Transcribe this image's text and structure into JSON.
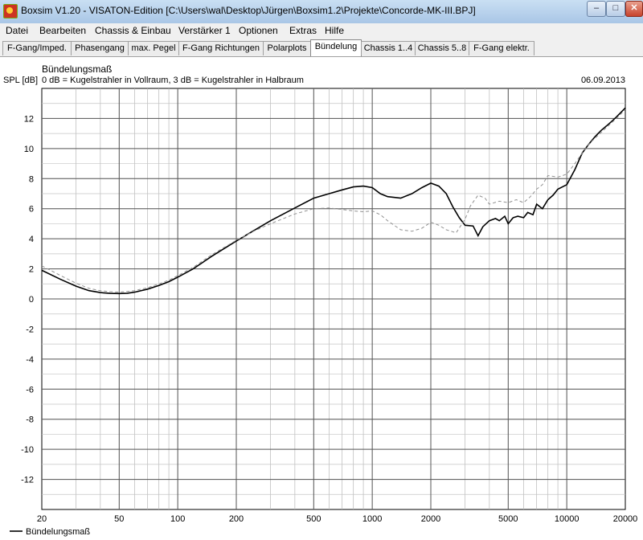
{
  "window": {
    "title": "Boxsim V1.20 - VISATON-Edition [C:\\Users\\wal\\Desktop\\Jürgen\\Boxsim1.2\\Projekte\\Concorde-MK-III.BPJ]",
    "icon": "boxsim-app-icon",
    "controls": {
      "minimize": "–",
      "maximize": "□",
      "close": "✕"
    }
  },
  "menu": [
    "Datei",
    "Bearbeiten",
    "Chassis & Einbau",
    "Verstärker 1",
    "Optionen",
    "Extras",
    "Hilfe"
  ],
  "tabs": [
    {
      "label": "F-Gang/Imped.",
      "active": false
    },
    {
      "label": "Phasengang",
      "active": false
    },
    {
      "label": "max. Pegel",
      "active": false
    },
    {
      "label": "F-Gang Richtungen",
      "active": false
    },
    {
      "label": "Polarplots",
      "active": false
    },
    {
      "label": "Bündelung",
      "active": true
    },
    {
      "label": "Chassis 1..4",
      "active": false
    },
    {
      "label": "Chassis 5..8",
      "active": false
    },
    {
      "label": "F-Gang elektr.",
      "active": false
    }
  ],
  "chart_data": {
    "type": "line",
    "title": "Bündelungsmaß",
    "subtitle": "0 dB = Kugelstrahler in Vollraum, 3 dB = Kugelstrahler in Halbraum",
    "date": "06.09.2013",
    "ylabel": "SPL [dB]",
    "xlabel": "",
    "x_scale": "log",
    "xlim": [
      20,
      20000
    ],
    "ylim": [
      -14,
      14
    ],
    "grid": true,
    "x_ticks": [
      20,
      50,
      100,
      200,
      500,
      1000,
      2000,
      5000,
      10000,
      20000
    ],
    "x_tick_labels": [
      "20",
      "50",
      "100",
      "200",
      "500",
      "1000",
      "2000",
      "5000",
      "10000",
      "20000"
    ],
    "y_ticks": [
      12,
      10,
      8,
      6,
      4,
      2,
      0,
      -2,
      -4,
      -6,
      -8,
      -10,
      -12
    ],
    "y_tick_labels": [
      "12",
      "10",
      "8",
      "6",
      "4",
      "2",
      "0",
      "-2",
      "-4",
      "-6",
      "-8",
      "-10",
      "-12"
    ],
    "legend_position": "bottom-left",
    "series": [
      {
        "name": "Bündelungsmaß",
        "style": "solid",
        "color": "#000000",
        "points": [
          [
            20,
            1.9
          ],
          [
            25,
            1.3
          ],
          [
            30,
            0.85
          ],
          [
            35,
            0.55
          ],
          [
            40,
            0.42
          ],
          [
            45,
            0.37
          ],
          [
            50,
            0.36
          ],
          [
            55,
            0.38
          ],
          [
            60,
            0.45
          ],
          [
            70,
            0.65
          ],
          [
            80,
            0.9
          ],
          [
            90,
            1.15
          ],
          [
            100,
            1.45
          ],
          [
            120,
            2.0
          ],
          [
            150,
            2.85
          ],
          [
            200,
            3.85
          ],
          [
            250,
            4.6
          ],
          [
            300,
            5.2
          ],
          [
            400,
            6.05
          ],
          [
            500,
            6.7
          ],
          [
            600,
            7.0
          ],
          [
            700,
            7.25
          ],
          [
            800,
            7.45
          ],
          [
            900,
            7.5
          ],
          [
            1000,
            7.4
          ],
          [
            1100,
            7.0
          ],
          [
            1200,
            6.8
          ],
          [
            1400,
            6.7
          ],
          [
            1600,
            7.0
          ],
          [
            1800,
            7.4
          ],
          [
            2000,
            7.7
          ],
          [
            2200,
            7.5
          ],
          [
            2400,
            7.0
          ],
          [
            2600,
            6.1
          ],
          [
            2800,
            5.4
          ],
          [
            3000,
            4.9
          ],
          [
            3300,
            4.85
          ],
          [
            3500,
            4.2
          ],
          [
            3700,
            4.8
          ],
          [
            4000,
            5.2
          ],
          [
            4300,
            5.35
          ],
          [
            4500,
            5.2
          ],
          [
            4800,
            5.5
          ],
          [
            5000,
            5.0
          ],
          [
            5300,
            5.4
          ],
          [
            5600,
            5.5
          ],
          [
            6000,
            5.4
          ],
          [
            6300,
            5.75
          ],
          [
            6700,
            5.6
          ],
          [
            7000,
            6.3
          ],
          [
            7500,
            6.0
          ],
          [
            8000,
            6.6
          ],
          [
            8500,
            6.9
          ],
          [
            9000,
            7.3
          ],
          [
            10000,
            7.6
          ],
          [
            11000,
            8.6
          ],
          [
            12000,
            9.7
          ],
          [
            13000,
            10.3
          ],
          [
            14000,
            10.8
          ],
          [
            15000,
            11.2
          ],
          [
            16000,
            11.5
          ],
          [
            17000,
            11.8
          ],
          [
            18000,
            12.1
          ],
          [
            20000,
            12.7
          ]
        ]
      },
      {
        "name": "",
        "style": "dashed",
        "color": "#909090",
        "points": [
          [
            20,
            2.2
          ],
          [
            25,
            1.55
          ],
          [
            30,
            1.05
          ],
          [
            35,
            0.7
          ],
          [
            40,
            0.55
          ],
          [
            45,
            0.48
          ],
          [
            50,
            0.45
          ],
          [
            60,
            0.55
          ],
          [
            70,
            0.75
          ],
          [
            80,
            1.0
          ],
          [
            90,
            1.25
          ],
          [
            100,
            1.55
          ],
          [
            120,
            2.1
          ],
          [
            150,
            2.95
          ],
          [
            200,
            3.9
          ],
          [
            250,
            4.55
          ],
          [
            300,
            5.0
          ],
          [
            400,
            5.65
          ],
          [
            500,
            6.0
          ],
          [
            600,
            6.05
          ],
          [
            700,
            5.95
          ],
          [
            800,
            5.85
          ],
          [
            900,
            5.8
          ],
          [
            1000,
            5.85
          ],
          [
            1100,
            5.6
          ],
          [
            1200,
            5.2
          ],
          [
            1400,
            4.6
          ],
          [
            1600,
            4.5
          ],
          [
            1800,
            4.7
          ],
          [
            2000,
            5.1
          ],
          [
            2200,
            4.9
          ],
          [
            2400,
            4.6
          ],
          [
            2700,
            4.4
          ],
          [
            3000,
            5.3
          ],
          [
            3200,
            6.2
          ],
          [
            3500,
            6.9
          ],
          [
            3800,
            6.7
          ],
          [
            4000,
            6.3
          ],
          [
            4500,
            6.5
          ],
          [
            5000,
            6.4
          ],
          [
            5500,
            6.6
          ],
          [
            6000,
            6.4
          ],
          [
            6500,
            6.8
          ],
          [
            7000,
            7.3
          ],
          [
            7500,
            7.6
          ],
          [
            8000,
            8.2
          ],
          [
            9000,
            8.1
          ],
          [
            10000,
            8.3
          ],
          [
            11000,
            9.0
          ],
          [
            12000,
            9.7
          ],
          [
            13000,
            10.3
          ],
          [
            14000,
            10.7
          ],
          [
            16000,
            11.4
          ],
          [
            18000,
            12.0
          ],
          [
            20000,
            12.6
          ]
        ]
      }
    ]
  }
}
